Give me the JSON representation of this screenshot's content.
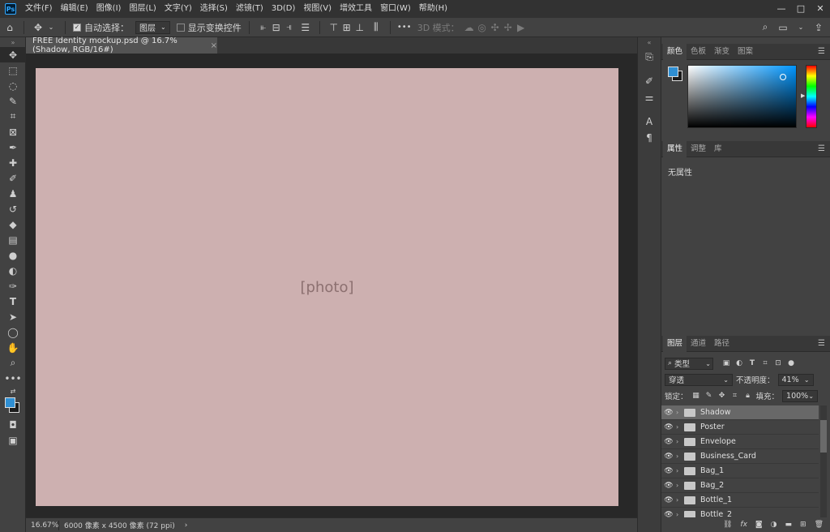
{
  "app": {
    "logo": "Ps"
  },
  "menu": [
    "文件(F)",
    "编辑(E)",
    "图像(I)",
    "图层(L)",
    "文字(Y)",
    "选择(S)",
    "滤镜(T)",
    "3D(D)",
    "视图(V)",
    "增效工具",
    "窗口(W)",
    "帮助(H)"
  ],
  "window_controls": {
    "minimize": "—",
    "maximize": "□",
    "close": "✕"
  },
  "options": {
    "auto_select_label": "自动选择：",
    "auto_select_value": "图层",
    "show_transform_label": "显示变换控件",
    "more": "•••",
    "mode_3d": "3D 模式："
  },
  "document": {
    "tab_title": "FREE Identity mockup.psd @ 16.7% (Shadow, RGB/16#)",
    "close": "×",
    "canvas_caption": "[photo]"
  },
  "status": {
    "zoom": "16.67%",
    "dimensions": "6000 像素 x 4500 像素 (72 ppi)",
    "arrow": "›"
  },
  "color_panel": {
    "tabs": [
      "颜色",
      "色板",
      "渐变",
      "图案"
    ],
    "foreground": "#2f8fd3",
    "background": "#1b1b1b"
  },
  "properties_panel": {
    "tabs": [
      "属性",
      "调整",
      "库"
    ],
    "empty_text": "无属性"
  },
  "layers_panel": {
    "tabs": [
      "图层",
      "通道",
      "路径"
    ],
    "filter_kind": "类型",
    "blend_mode": "穿透",
    "opacity_label": "不透明度：",
    "opacity_value": "41%",
    "lock_label": "锁定：",
    "fill_label": "填充：",
    "fill_value": "100%",
    "layers": [
      {
        "name": "Shadow",
        "selected": true
      },
      {
        "name": "Poster",
        "selected": false
      },
      {
        "name": "Envelope",
        "selected": false
      },
      {
        "name": "Business_Card",
        "selected": false
      },
      {
        "name": "Bag_1",
        "selected": false
      },
      {
        "name": "Bag_2",
        "selected": false
      },
      {
        "name": "Bottle_1",
        "selected": false
      },
      {
        "name": "Bottle_2",
        "selected": false
      }
    ],
    "footer_icons": [
      "link",
      "fx",
      "mask",
      "adjustment",
      "group",
      "new",
      "delete"
    ]
  },
  "colors": {
    "accent": "#31a8ff",
    "panel": "#424242",
    "menubar": "#323232"
  }
}
